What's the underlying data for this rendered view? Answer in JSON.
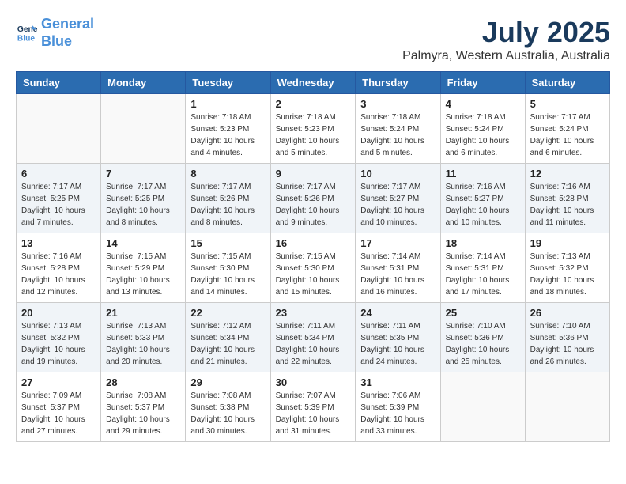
{
  "header": {
    "logo_line1": "General",
    "logo_line2": "Blue",
    "month": "July 2025",
    "location": "Palmyra, Western Australia, Australia"
  },
  "days_of_week": [
    "Sunday",
    "Monday",
    "Tuesday",
    "Wednesday",
    "Thursday",
    "Friday",
    "Saturday"
  ],
  "weeks": [
    [
      {
        "day": "",
        "sunrise": "",
        "sunset": "",
        "daylight": ""
      },
      {
        "day": "",
        "sunrise": "",
        "sunset": "",
        "daylight": ""
      },
      {
        "day": "1",
        "sunrise": "Sunrise: 7:18 AM",
        "sunset": "Sunset: 5:23 PM",
        "daylight": "Daylight: 10 hours and 4 minutes."
      },
      {
        "day": "2",
        "sunrise": "Sunrise: 7:18 AM",
        "sunset": "Sunset: 5:23 PM",
        "daylight": "Daylight: 10 hours and 5 minutes."
      },
      {
        "day": "3",
        "sunrise": "Sunrise: 7:18 AM",
        "sunset": "Sunset: 5:24 PM",
        "daylight": "Daylight: 10 hours and 5 minutes."
      },
      {
        "day": "4",
        "sunrise": "Sunrise: 7:18 AM",
        "sunset": "Sunset: 5:24 PM",
        "daylight": "Daylight: 10 hours and 6 minutes."
      },
      {
        "day": "5",
        "sunrise": "Sunrise: 7:17 AM",
        "sunset": "Sunset: 5:24 PM",
        "daylight": "Daylight: 10 hours and 6 minutes."
      }
    ],
    [
      {
        "day": "6",
        "sunrise": "Sunrise: 7:17 AM",
        "sunset": "Sunset: 5:25 PM",
        "daylight": "Daylight: 10 hours and 7 minutes."
      },
      {
        "day": "7",
        "sunrise": "Sunrise: 7:17 AM",
        "sunset": "Sunset: 5:25 PM",
        "daylight": "Daylight: 10 hours and 8 minutes."
      },
      {
        "day": "8",
        "sunrise": "Sunrise: 7:17 AM",
        "sunset": "Sunset: 5:26 PM",
        "daylight": "Daylight: 10 hours and 8 minutes."
      },
      {
        "day": "9",
        "sunrise": "Sunrise: 7:17 AM",
        "sunset": "Sunset: 5:26 PM",
        "daylight": "Daylight: 10 hours and 9 minutes."
      },
      {
        "day": "10",
        "sunrise": "Sunrise: 7:17 AM",
        "sunset": "Sunset: 5:27 PM",
        "daylight": "Daylight: 10 hours and 10 minutes."
      },
      {
        "day": "11",
        "sunrise": "Sunrise: 7:16 AM",
        "sunset": "Sunset: 5:27 PM",
        "daylight": "Daylight: 10 hours and 10 minutes."
      },
      {
        "day": "12",
        "sunrise": "Sunrise: 7:16 AM",
        "sunset": "Sunset: 5:28 PM",
        "daylight": "Daylight: 10 hours and 11 minutes."
      }
    ],
    [
      {
        "day": "13",
        "sunrise": "Sunrise: 7:16 AM",
        "sunset": "Sunset: 5:28 PM",
        "daylight": "Daylight: 10 hours and 12 minutes."
      },
      {
        "day": "14",
        "sunrise": "Sunrise: 7:15 AM",
        "sunset": "Sunset: 5:29 PM",
        "daylight": "Daylight: 10 hours and 13 minutes."
      },
      {
        "day": "15",
        "sunrise": "Sunrise: 7:15 AM",
        "sunset": "Sunset: 5:30 PM",
        "daylight": "Daylight: 10 hours and 14 minutes."
      },
      {
        "day": "16",
        "sunrise": "Sunrise: 7:15 AM",
        "sunset": "Sunset: 5:30 PM",
        "daylight": "Daylight: 10 hours and 15 minutes."
      },
      {
        "day": "17",
        "sunrise": "Sunrise: 7:14 AM",
        "sunset": "Sunset: 5:31 PM",
        "daylight": "Daylight: 10 hours and 16 minutes."
      },
      {
        "day": "18",
        "sunrise": "Sunrise: 7:14 AM",
        "sunset": "Sunset: 5:31 PM",
        "daylight": "Daylight: 10 hours and 17 minutes."
      },
      {
        "day": "19",
        "sunrise": "Sunrise: 7:13 AM",
        "sunset": "Sunset: 5:32 PM",
        "daylight": "Daylight: 10 hours and 18 minutes."
      }
    ],
    [
      {
        "day": "20",
        "sunrise": "Sunrise: 7:13 AM",
        "sunset": "Sunset: 5:32 PM",
        "daylight": "Daylight: 10 hours and 19 minutes."
      },
      {
        "day": "21",
        "sunrise": "Sunrise: 7:13 AM",
        "sunset": "Sunset: 5:33 PM",
        "daylight": "Daylight: 10 hours and 20 minutes."
      },
      {
        "day": "22",
        "sunrise": "Sunrise: 7:12 AM",
        "sunset": "Sunset: 5:34 PM",
        "daylight": "Daylight: 10 hours and 21 minutes."
      },
      {
        "day": "23",
        "sunrise": "Sunrise: 7:11 AM",
        "sunset": "Sunset: 5:34 PM",
        "daylight": "Daylight: 10 hours and 22 minutes."
      },
      {
        "day": "24",
        "sunrise": "Sunrise: 7:11 AM",
        "sunset": "Sunset: 5:35 PM",
        "daylight": "Daylight: 10 hours and 24 minutes."
      },
      {
        "day": "25",
        "sunrise": "Sunrise: 7:10 AM",
        "sunset": "Sunset: 5:36 PM",
        "daylight": "Daylight: 10 hours and 25 minutes."
      },
      {
        "day": "26",
        "sunrise": "Sunrise: 7:10 AM",
        "sunset": "Sunset: 5:36 PM",
        "daylight": "Daylight: 10 hours and 26 minutes."
      }
    ],
    [
      {
        "day": "27",
        "sunrise": "Sunrise: 7:09 AM",
        "sunset": "Sunset: 5:37 PM",
        "daylight": "Daylight: 10 hours and 27 minutes."
      },
      {
        "day": "28",
        "sunrise": "Sunrise: 7:08 AM",
        "sunset": "Sunset: 5:37 PM",
        "daylight": "Daylight: 10 hours and 29 minutes."
      },
      {
        "day": "29",
        "sunrise": "Sunrise: 7:08 AM",
        "sunset": "Sunset: 5:38 PM",
        "daylight": "Daylight: 10 hours and 30 minutes."
      },
      {
        "day": "30",
        "sunrise": "Sunrise: 7:07 AM",
        "sunset": "Sunset: 5:39 PM",
        "daylight": "Daylight: 10 hours and 31 minutes."
      },
      {
        "day": "31",
        "sunrise": "Sunrise: 7:06 AM",
        "sunset": "Sunset: 5:39 PM",
        "daylight": "Daylight: 10 hours and 33 minutes."
      },
      {
        "day": "",
        "sunrise": "",
        "sunset": "",
        "daylight": ""
      },
      {
        "day": "",
        "sunrise": "",
        "sunset": "",
        "daylight": ""
      }
    ]
  ]
}
